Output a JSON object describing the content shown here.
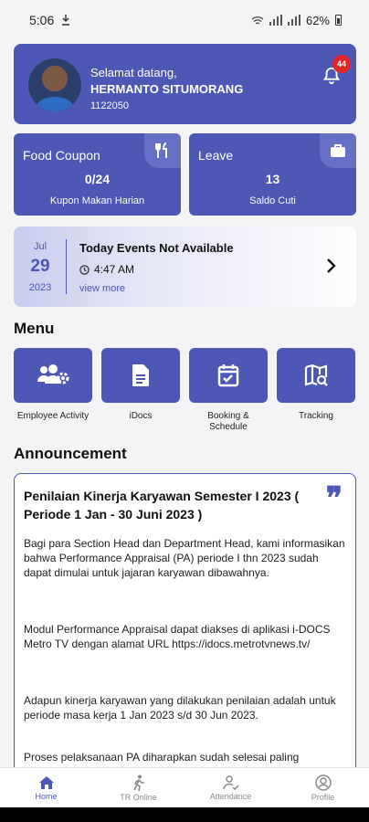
{
  "status": {
    "time": "5:06",
    "battery": "62%"
  },
  "user": {
    "greeting": "Selamat datang,",
    "name": "HERMANTO SITUMORANG",
    "id": "1122050",
    "notification_count": "44"
  },
  "food_coupon": {
    "title": "Food Coupon",
    "value": "0/24",
    "subtitle": "Kupon Makan Harian"
  },
  "leave": {
    "title": "Leave",
    "value": "13",
    "subtitle": "Saldo Cuti"
  },
  "event": {
    "month": "Jul",
    "day": "29",
    "year": "2023",
    "title": "Today Events Not Available",
    "time": "4:47 AM",
    "link": "view more"
  },
  "menu": {
    "title": "Menu",
    "items": [
      {
        "label": "Employee Activity",
        "icon": "people-gear-icon"
      },
      {
        "label": "iDocs",
        "icon": "document-icon"
      },
      {
        "label": "Booking & Schedule",
        "icon": "calendar-check-icon"
      },
      {
        "label": "Tracking",
        "icon": "map-search-icon"
      }
    ]
  },
  "announcement": {
    "section_title": "Announcement",
    "title": "Penilaian Kinerja Karyawan Semester I 2023 ( Periode 1 Jan - 30 Juni 2023 )",
    "paragraphs": [
      "Bagi para Section Head dan Department Head, kami informasikan bahwa Performance Appraisal (PA) periode I thn 2023 sudah dapat dimulai untuk jajaran karyawan dibawahnya.",
      "Modul Performance Appraisal dapat diakses di aplikasi i-DOCS Metro TV dengan alamat URL https://idocs.metrotvnews.tv/",
      "Adapun kinerja karyawan yang dilakukan penilaian adalah untuk periode masa kerja 1 Jan 2023 s/d 30 Jun 2023.",
      "Proses pelaksanaan PA diharapkan sudah selesai paling"
    ]
  },
  "nav": {
    "items": [
      {
        "label": "Home"
      },
      {
        "label": "TR Online"
      },
      {
        "label": "Attendance"
      },
      {
        "label": "Profile"
      }
    ]
  },
  "colors": {
    "primary": "#4d57b5",
    "badge": "#e32626"
  }
}
